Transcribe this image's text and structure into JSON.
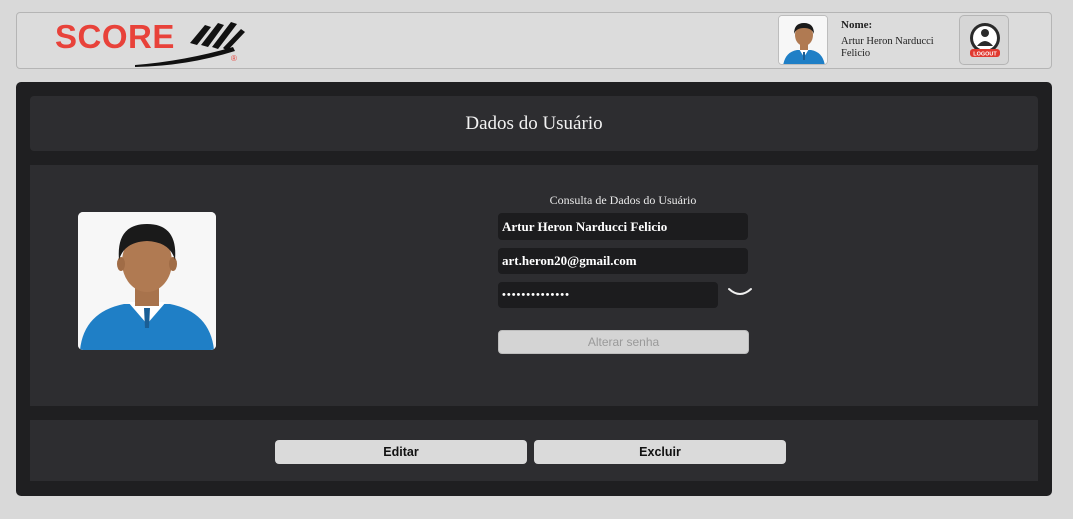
{
  "header": {
    "logo_text": "SCORE",
    "logo_mark": "®",
    "name_label": "Nome:",
    "user_name": "Artur Heron Narducci Felicio",
    "logout_label": "LOGOUT",
    "icons": {
      "avatar": "user-avatar-icon",
      "logout": "logout-icon"
    }
  },
  "panel": {
    "title": "Dados do Usuário",
    "section_title": "Consulta de Dados do Usuário",
    "fields": {
      "name": "Artur Heron Narducci Felicio",
      "email": "art.heron20@gmail.com",
      "password_mask": "••••••••••••••"
    },
    "alter_password_label": "Alterar senha",
    "edit_label": "Editar",
    "delete_label": "Excluir"
  },
  "colors": {
    "brand": "#e8423a",
    "panel_bg": "#1f1f21",
    "card_bg": "#2d2d30",
    "field_bg": "#1c1c1e",
    "button_bg": "#dadada"
  }
}
